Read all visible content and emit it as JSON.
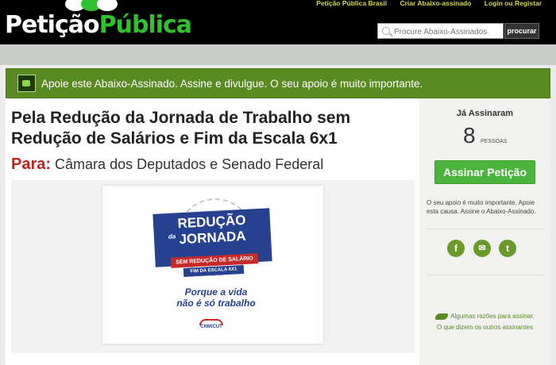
{
  "header": {
    "logo_part1": "Petição",
    "logo_part2": "Pública",
    "links": [
      "Petição Pública Brasil",
      "Criar Abaixo-assinado",
      "Login ou Registar"
    ],
    "search_placeholder": "Procure Abaixo-Assinados",
    "search_button": "procurar"
  },
  "banner": {
    "text": "Apoie este Abaixo-Assinado. Assine e divulgue. O seu apoio é muito importante."
  },
  "petition": {
    "title": "Pela Redução da Jornada de Trabalho sem Redução de Salários e Fim da Escala 6x1",
    "to_label": "Para:",
    "to_value": "Câmara dos Deputados e Senado Federal",
    "image": {
      "line1": "REDUÇÃO",
      "line2": "da",
      "line3": "JORNADA",
      "strip1": "SEM REDUÇÃO DE SALÁRIO",
      "strip2": "FIM DA ESCALA 6X1",
      "slogan1": "Porque a vida",
      "slogan2": "não é só trabalho",
      "logo": "CNM/CUT"
    }
  },
  "sidebar": {
    "signed_label": "Já Assinaram",
    "count": "8",
    "count_unit": "PESSOAS",
    "sign_button": "Assinar Petição",
    "support_text": "O seu apoio é muito importante. Apoie esta causa. Assine o Abaixo-Assinado.",
    "social": [
      "f",
      "✉",
      "t"
    ],
    "reasons_link": "Algumas razões para assinar.",
    "others_link": "O que dizem os outros assinantes"
  },
  "colors": {
    "brand_green": "#5a8a22",
    "button_green": "#4bb43c",
    "to_red": "#c0211c",
    "link_yellow": "#d6d94a"
  }
}
